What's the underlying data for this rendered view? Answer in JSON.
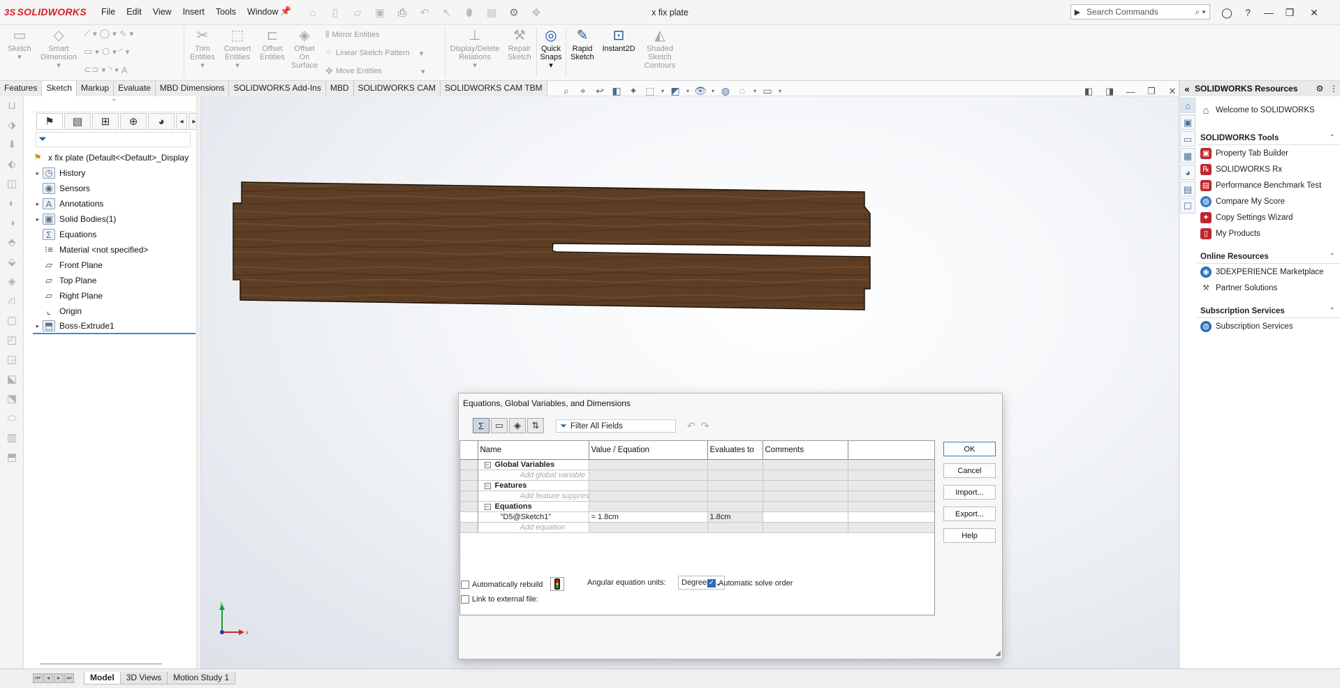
{
  "app": {
    "logo_text": "SOLIDWORKS",
    "logo_prefix": "3S",
    "menu": [
      "File",
      "Edit",
      "View",
      "Insert",
      "Tools",
      "Window"
    ],
    "document_title": "x fix plate",
    "search_placeholder": "Search Commands",
    "accent_color": "#d3202a"
  },
  "ribbon": {
    "sketch": "Sketch",
    "smart_dimension_1": "Smart",
    "smart_dimension_2": "Dimension",
    "trim_1": "Trim",
    "trim_2": "Entities",
    "convert_1": "Convert",
    "convert_2": "Entities",
    "offset_1": "Offset",
    "offset_2": "Entities",
    "offset_surface_1": "Offset",
    "offset_surface_2": "On",
    "offset_surface_3": "Surface",
    "mirror": "Mirror Entities",
    "linear_pattern": "Linear Sketch Pattern",
    "move": "Move Entities",
    "display_delete_1": "Display/Delete",
    "display_delete_2": "Relations",
    "repair_1": "Repair",
    "repair_2": "Sketch",
    "quick_snaps_1": "Quick",
    "quick_snaps_2": "Snaps",
    "rapid_1": "Rapid",
    "rapid_2": "Sketch",
    "instant2d": "Instant2D",
    "shaded_1": "Shaded",
    "shaded_2": "Sketch",
    "shaded_3": "Contours"
  },
  "tabs": [
    "Features",
    "Sketch",
    "Markup",
    "Evaluate",
    "MBD Dimensions",
    "SOLIDWORKS Add-Ins",
    "MBD",
    "SOLIDWORKS CAM",
    "SOLIDWORKS CAM TBM"
  ],
  "active_tab": "Sketch",
  "feature_tree": {
    "root": "x fix plate  (Default<<Default>_Display",
    "items": [
      {
        "label": "History",
        "expandable": true,
        "icon": "history-icon"
      },
      {
        "label": "Sensors",
        "expandable": false,
        "icon": "sensors-icon"
      },
      {
        "label": "Annotations",
        "expandable": true,
        "icon": "annotations-icon"
      },
      {
        "label": "Solid Bodies(1)",
        "expandable": true,
        "icon": "solid-bodies-icon"
      },
      {
        "label": "Equations",
        "expandable": false,
        "icon": "equations-icon"
      },
      {
        "label": "Material <not specified>",
        "expandable": false,
        "icon": "material-icon"
      },
      {
        "label": "Front Plane",
        "expandable": false,
        "icon": "plane-icon"
      },
      {
        "label": "Top Plane",
        "expandable": false,
        "icon": "plane-icon"
      },
      {
        "label": "Right Plane",
        "expandable": false,
        "icon": "plane-icon"
      },
      {
        "label": "Origin",
        "expandable": false,
        "icon": "origin-icon"
      },
      {
        "label": "Boss-Extrude1",
        "expandable": true,
        "icon": "extrude-icon"
      }
    ]
  },
  "triad": {
    "x": "x",
    "y": "y"
  },
  "bottom_tabs": [
    "Model",
    "3D Views",
    "Motion Study 1"
  ],
  "active_bottom_tab": "Model",
  "task_pane": {
    "title": "SOLIDWORKS Resources",
    "welcome": "Welcome to SOLIDWORKS",
    "sections": [
      {
        "title": "SOLIDWORKS Tools",
        "items": [
          "Property Tab Builder",
          "SOLIDWORKS Rx",
          "Performance Benchmark Test",
          "Compare My Score",
          "Copy Settings Wizard",
          "My Products"
        ]
      },
      {
        "title": "Online Resources",
        "items": [
          "3DEXPERIENCE Marketplace",
          "Partner Solutions"
        ]
      },
      {
        "title": "Subscription Services",
        "items": [
          "Subscription Services"
        ]
      }
    ]
  },
  "dialog": {
    "title": "Equations, Global Variables, and Dimensions",
    "filter": "Filter All Fields",
    "columns": [
      "Name",
      "Value / Equation",
      "Evaluates to",
      "Comments"
    ],
    "global_variables": "Global Variables",
    "add_global_variable": "Add global variable",
    "features": "Features",
    "add_feature_suppression": "Add feature suppression",
    "equations": "Equations",
    "equation_row": {
      "name": "\"D5@Sketch1\"",
      "value": "= 1.8cm",
      "evaluates": "1.8cm",
      "comment": ""
    },
    "add_equation": "Add equation",
    "buttons": {
      "ok": "OK",
      "cancel": "Cancel",
      "import": "Import...",
      "export": "Export...",
      "help": "Help"
    },
    "auto_rebuild": "Automatically rebuild",
    "auto_rebuild_checked": false,
    "link_external": "Link to external file:",
    "link_external_checked": false,
    "angular_label": "Angular equation units:",
    "angular_value": "Degrees",
    "auto_solve": "Automatic solve order",
    "auto_solve_checked": true
  }
}
